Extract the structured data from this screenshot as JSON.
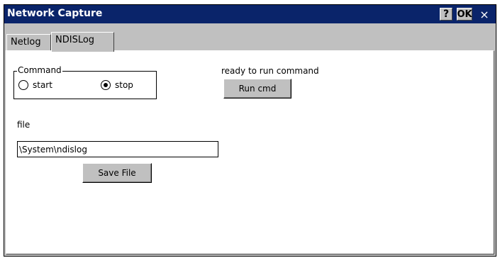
{
  "window": {
    "title": "Network Capture",
    "help_label": "?",
    "ok_label": "OK",
    "close_label": "×"
  },
  "tabs": [
    {
      "label": "Netlog",
      "active": false
    },
    {
      "label": "NDISLog",
      "active": true
    }
  ],
  "command": {
    "group_label": "Command",
    "options": [
      {
        "label": "start",
        "checked": false
      },
      {
        "label": "stop",
        "checked": true
      }
    ]
  },
  "status": {
    "text": "ready to run command",
    "run_label": "Run cmd"
  },
  "file": {
    "label": "file",
    "value": "\\System\\ndislog",
    "save_label": "Save File"
  },
  "colors": {
    "titlebar": "#0a246a",
    "face": "#c0c0c0"
  }
}
